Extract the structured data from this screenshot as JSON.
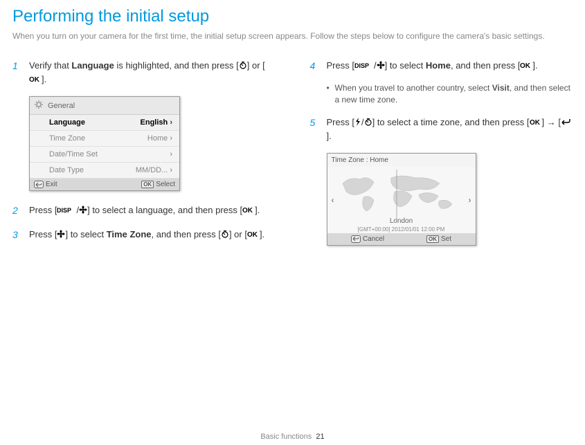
{
  "title": "Performing the initial setup",
  "intro": "When you turn on your camera for the first time, the initial setup screen appears. Follow the steps below to configure the camera's basic settings.",
  "steps": {
    "s1": {
      "num": "1",
      "pre": "Verify that ",
      "b1": "Language",
      "mid": " is highlighted, and then press [",
      "mid2": "] or [",
      "post": "]."
    },
    "s2": {
      "num": "2",
      "pre": "Press [",
      "mid": "] to select a language, and then press [",
      "post": "]."
    },
    "s3": {
      "num": "3",
      "pre": "Press [",
      "mid": "] to select ",
      "b1": "Time Zone",
      "mid2": ", and then press [",
      "mid3": "] or [",
      "post": "]."
    },
    "s4": {
      "num": "4",
      "pre": "Press [",
      "mid": "] to select ",
      "b1": "Home",
      "mid2": ", and then press [",
      "post": "]."
    },
    "s4b": {
      "pre": "When you travel to another country, select ",
      "b1": "Visit",
      "post": ", and then select a new time zone."
    },
    "s5": {
      "num": "5",
      "pre": "Press [",
      "mid": "] to select a time zone, and then press [",
      "mid2": "] → [",
      "post": "]."
    }
  },
  "menu": {
    "header": "General",
    "rows": [
      {
        "label": "Language",
        "value": "English",
        "hl": true
      },
      {
        "label": "Time Zone",
        "value": "Home"
      },
      {
        "label": "Date/Time Set",
        "value": ""
      },
      {
        "label": "Date Type",
        "value": "MM/DD..."
      }
    ],
    "exit": "Exit",
    "select": "Select"
  },
  "map": {
    "title": "Time Zone : Home",
    "city": "London",
    "gmt": "[GMT+00:00] 2012/01/01 12:00 PM",
    "cancel": "Cancel",
    "set": "Set"
  },
  "footer": {
    "section": "Basic functions",
    "page": "21"
  },
  "icons": {
    "disp": "DISP",
    "ok": "OK"
  }
}
